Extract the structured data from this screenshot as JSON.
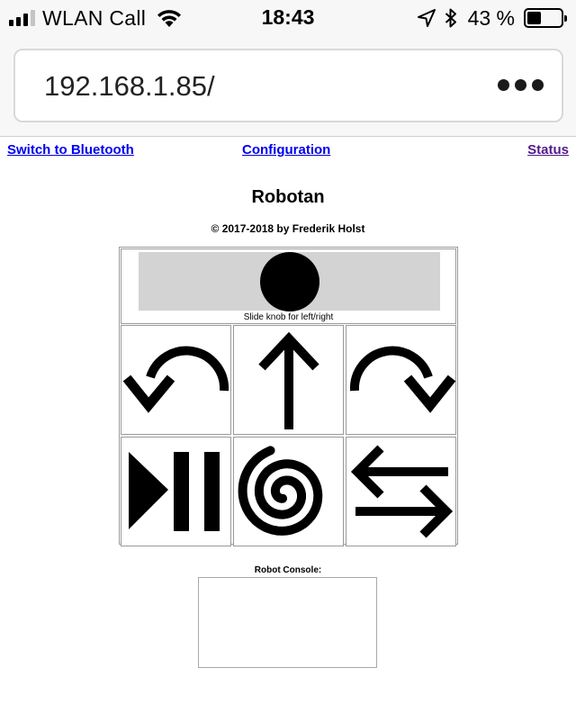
{
  "status_bar": {
    "carrier": "WLAN Call",
    "time": "18:43",
    "battery_percent": "43 %",
    "battery_level": 0.43,
    "signal_bars_active": 3,
    "signal_bars_total": 4,
    "icons": [
      "wifi-icon",
      "location-arrow-icon",
      "bluetooth-icon",
      "battery-icon"
    ]
  },
  "browser": {
    "url": "192.168.1.85/",
    "more_icon": "more-dots-icon"
  },
  "nav": {
    "bluetooth_link": "Switch to Bluetooth",
    "config_link": "Configuration",
    "status_link": "Status"
  },
  "page": {
    "title": "Robotan",
    "copyright": "© 2017-2018 by Frederik Holst"
  },
  "controls": {
    "slider_caption": "Slide knob for left/right",
    "slider_value": 0.5,
    "buttons": [
      {
        "name": "turn-left-button",
        "icon": "curved-arrow-left-icon"
      },
      {
        "name": "forward-button",
        "icon": "arrow-up-icon"
      },
      {
        "name": "turn-right-button",
        "icon": "curved-arrow-right-icon"
      },
      {
        "name": "play-pause-button",
        "icon": "play-pause-icon"
      },
      {
        "name": "spiral-button",
        "icon": "spiral-icon"
      },
      {
        "name": "back-and-forth-button",
        "icon": "arrows-left-right-icon"
      }
    ]
  },
  "console": {
    "label": "Robot Console:",
    "content": ""
  },
  "colors": {
    "link": "#0000ee",
    "visited_link": "#551a8b",
    "slider_track": "#d3d3d3",
    "chrome_bg": "#f7f7f7"
  }
}
